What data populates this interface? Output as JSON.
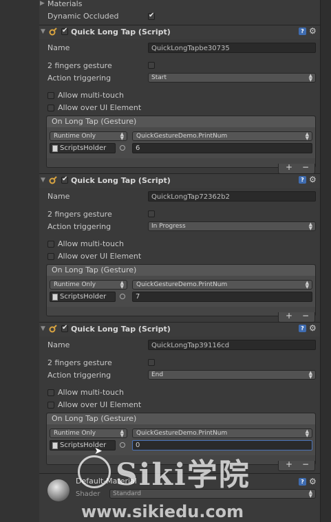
{
  "materials_header": "Materials",
  "dynamic_occluded": {
    "label": "Dynamic Occluded",
    "checked": true
  },
  "components": [
    {
      "title": "Quick Long Tap (Script)",
      "name_label": "Name",
      "name_value": "QuickLongTapbe30735",
      "two_fingers_label": "2 fingers gesture",
      "action_label": "Action triggering",
      "action_value": "Start",
      "allow_multitouch": "Allow multi-touch",
      "allow_over_ui": "Allow over UI Element",
      "event_title": "On Long Tap (Gesture)",
      "runtime": "Runtime Only",
      "method": "QuickGestureDemo.PrintNum",
      "object": "ScriptsHolder",
      "arg": "6"
    },
    {
      "title": "Quick Long Tap (Script)",
      "name_label": "Name",
      "name_value": "QuickLongTap72362b2",
      "two_fingers_label": "2 fingers gesture",
      "action_label": "Action triggering",
      "action_value": "In Progress",
      "allow_multitouch": "Allow multi-touch",
      "allow_over_ui": "Allow over UI Element",
      "event_title": "On Long Tap (Gesture)",
      "runtime": "Runtime Only",
      "method": "QuickGestureDemo.PrintNum",
      "object": "ScriptsHolder",
      "arg": "7"
    },
    {
      "title": "Quick Long Tap (Script)",
      "name_label": "Name",
      "name_value": "QuickLongTap39116cd",
      "two_fingers_label": "2 fingers gesture",
      "action_label": "Action triggering",
      "action_value": "End",
      "allow_multitouch": "Allow multi-touch",
      "allow_over_ui": "Allow over UI Element",
      "event_title": "On Long Tap (Gesture)",
      "runtime": "Runtime Only",
      "method": "QuickGestureDemo.PrintNum",
      "object": "ScriptsHolder",
      "arg": "0"
    }
  ],
  "material": {
    "name": "Default-Material",
    "shader_label": "Shader",
    "shader_value": "Standard"
  },
  "plus": "+",
  "minus": "−",
  "watermark": {
    "brand": "Siki学院",
    "url": "www.sikiedu.com"
  }
}
